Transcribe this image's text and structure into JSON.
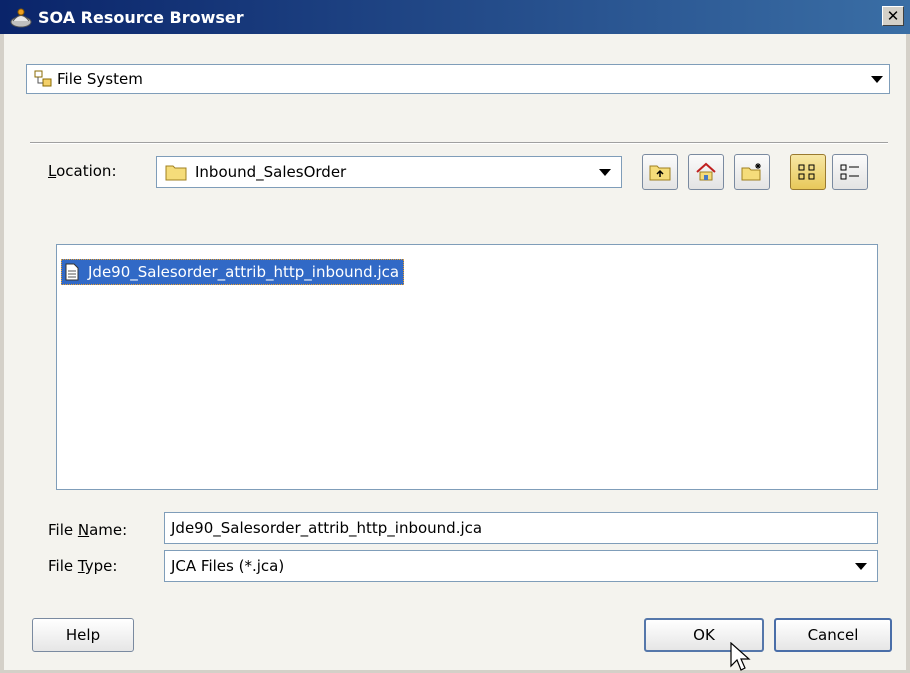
{
  "window": {
    "title": "SOA Resource Browser",
    "close_glyph": "✕"
  },
  "source": {
    "selected": "File System",
    "icon": "file-system-icon"
  },
  "location": {
    "label_prefix": "",
    "label_accel": "L",
    "label_rest": "ocation:",
    "value": "Inbound_SalesOrder",
    "icon": "folder-icon"
  },
  "toolbar": {
    "buttons": [
      {
        "name": "up-folder-button",
        "icon": "up-folder-icon"
      },
      {
        "name": "home-button",
        "icon": "home-icon"
      },
      {
        "name": "new-folder-button",
        "icon": "new-folder-icon"
      },
      {
        "name": "list-view-button",
        "icon": "list-view-icon"
      },
      {
        "name": "details-view-button",
        "icon": "details-view-icon"
      }
    ]
  },
  "files": [
    {
      "name": "Jde90_Salesorder_attrib_http_inbound.jca",
      "selected": true
    }
  ],
  "filename": {
    "label_prefix": "File ",
    "label_accel": "N",
    "label_rest": "ame:",
    "value": "Jde90_Salesorder_attrib_http_inbound.jca"
  },
  "filetype": {
    "label_prefix": "File ",
    "label_accel": "T",
    "label_rest": "ype:",
    "value": "JCA Files (*.jca)"
  },
  "buttons": {
    "help": "Help",
    "ok": "OK",
    "cancel": "Cancel"
  },
  "colors": {
    "titlebar_start": "#0a246a",
    "titlebar_end": "#3a6ea5",
    "selection": "#3169c6"
  }
}
